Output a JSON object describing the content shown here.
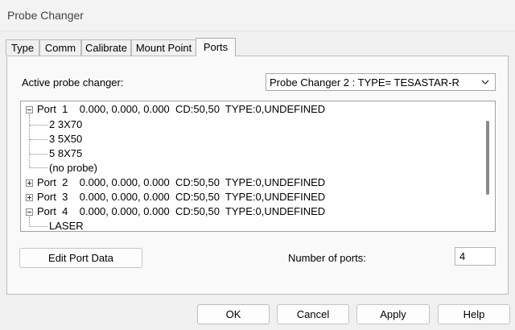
{
  "window": {
    "title": "Probe Changer"
  },
  "tabs": [
    {
      "label": "Type"
    },
    {
      "label": "Comm"
    },
    {
      "label": "Calibrate"
    },
    {
      "label": "Mount Point"
    },
    {
      "label": "Ports"
    }
  ],
  "active_tab": "Ports",
  "active_changer": {
    "label": "Active probe changer:",
    "value": "Probe Changer 2 : TYPE= TESASTAR-R"
  },
  "tree": {
    "ports": [
      {
        "text": "Port  1    0.000, 0.000, 0.000  CD:50,50  TYPE:0,UNDEFINED",
        "expanded": true,
        "children": [
          "2 3X70",
          "3 5X50",
          "5 8X75",
          "(no probe)"
        ]
      },
      {
        "text": "Port  2    0.000, 0.000, 0.000  CD:50,50  TYPE:0,UNDEFINED",
        "expanded": false,
        "children": []
      },
      {
        "text": "Port  3    0.000, 0.000, 0.000  CD:50,50  TYPE:0,UNDEFINED",
        "expanded": false,
        "children": []
      },
      {
        "text": "Port  4    0.000, 0.000, 0.000  CD:50,50  TYPE:0,UNDEFINED",
        "expanded": true,
        "children": [
          "LASER"
        ]
      }
    ]
  },
  "edit_port_button": "Edit Port Data",
  "num_ports": {
    "label": "Number of ports:",
    "value": "4"
  },
  "footer": {
    "ok": "OK",
    "cancel": "Cancel",
    "apply": "Apply",
    "help": "Help"
  }
}
